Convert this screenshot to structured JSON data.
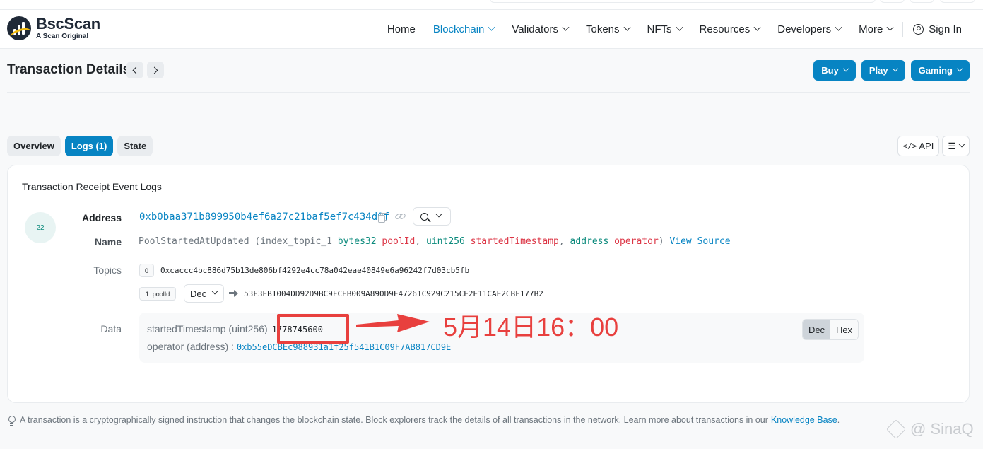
{
  "header": {
    "logo_name": "BscScan",
    "logo_sub": "A Scan Original",
    "nav": [
      {
        "label": "Home"
      },
      {
        "label": "Blockchain"
      },
      {
        "label": "Validators"
      },
      {
        "label": "Tokens"
      },
      {
        "label": "NFTs"
      },
      {
        "label": "Resources"
      },
      {
        "label": "Developers"
      },
      {
        "label": "More"
      }
    ],
    "signin": "Sign In"
  },
  "page": {
    "title": "Transaction Details",
    "buttons": {
      "buy": "Buy",
      "play": "Play",
      "gaming": "Gaming"
    }
  },
  "tabs": {
    "overview": "Overview",
    "logs": "Logs (1)",
    "state": "State",
    "api": "API"
  },
  "log": {
    "card_title": "Transaction Receipt Event Logs",
    "index": "22",
    "labels": {
      "address": "Address",
      "name": "Name",
      "topics": "Topics",
      "data": "Data"
    },
    "address": "0xb0baa371b899950b4ef6a27c21baf5ef7c434d0f",
    "signature": {
      "event": "PoolStartedAtUpdated",
      "open": " (index_topic_1 ",
      "t1": "bytes32",
      "p1": "poolId",
      "t2": "uint256",
      "p2": "startedTimestamp",
      "t3": "address",
      "p3": "operator",
      "close": ")",
      "view_source": "View Source"
    },
    "topics": [
      {
        "badge": "0",
        "value": "0xcaccc4bc886d75b13de806bf4292e4cc78a042eae40849e6a96242f7d03cb5fb"
      },
      {
        "badge": "1: poolId",
        "format": "Dec",
        "value": "53F3EB1004DD92D9BC9FCEB009A890D9F47261C929C215CE2E11CAE2CBF177B2"
      }
    ],
    "data": {
      "line1_label": "startedTimestamp (uint256)",
      "line1_value": "1778745600",
      "line2_label": "operator (address) : ",
      "line2_value": "0xb55eDCBEc988931a1f25f541B1C09F7AB817CD9E",
      "dec": "Dec",
      "hex": "Hex"
    }
  },
  "annotation": {
    "text": "5月14日16：00",
    "color": "#e8403e"
  },
  "footer": {
    "note": "A transaction is a cryptographically signed instruction that changes the blockchain state. Block explorers track the details of all transactions in the network. Learn more about transactions in our ",
    "link": "Knowledge Base",
    "end": "."
  },
  "watermark": "@ SinaQ",
  "colors": {
    "accent": "#0784c3",
    "param_type": "#0b8a7c",
    "param_name": "#dc3545"
  }
}
